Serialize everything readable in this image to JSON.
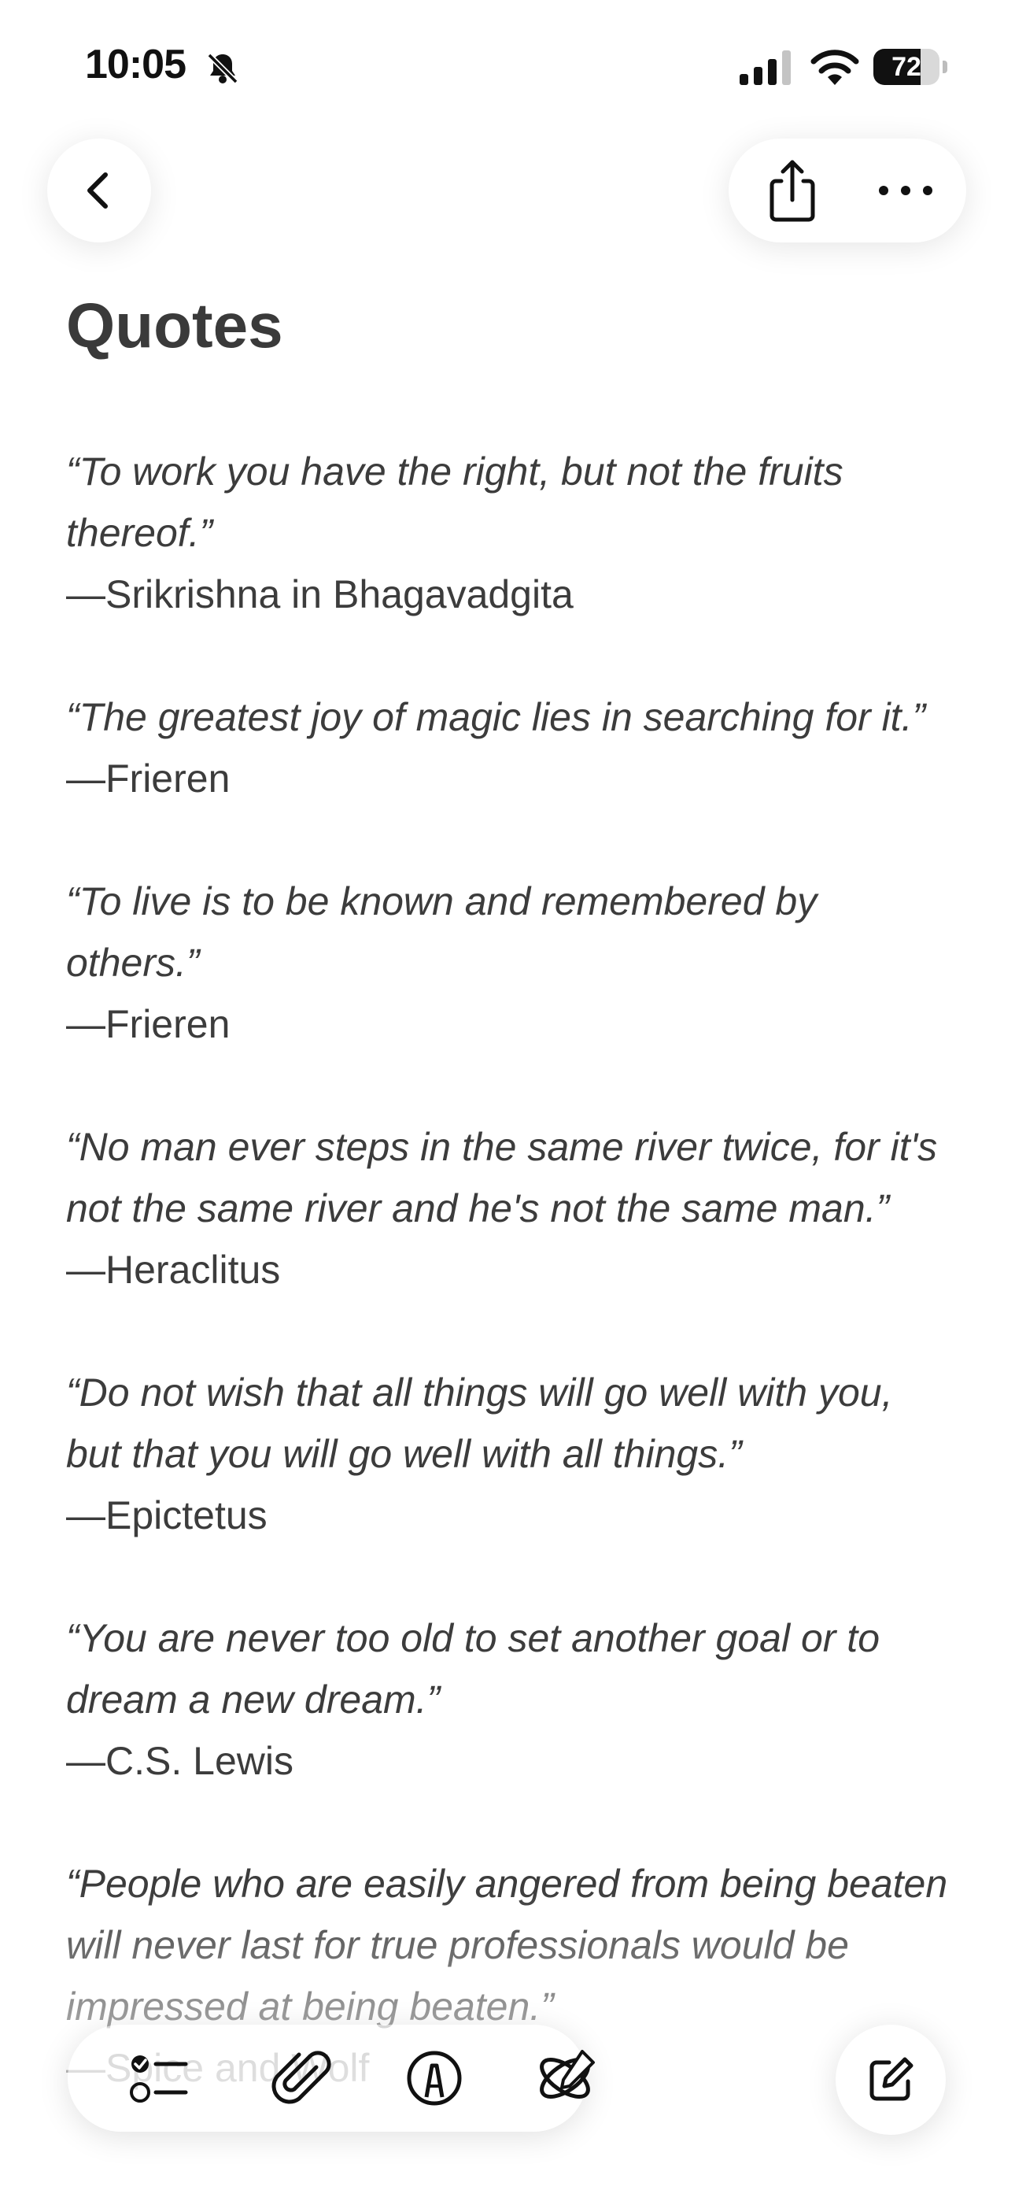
{
  "status_bar": {
    "time": "10:05",
    "battery_level": "72",
    "battery_fraction": 0.72,
    "icons": [
      "bell-slash-icon",
      "cellular-signal-icon",
      "wifi-icon",
      "battery-icon"
    ]
  },
  "nav": {
    "icons": [
      "chevron-left-icon",
      "share-icon",
      "ellipsis-icon"
    ]
  },
  "note": {
    "title": "Quotes",
    "quotes": [
      {
        "text": "“To work you have the right, but not the fruits thereof.”",
        "author": "—Srikrishna in Bhagavadgita"
      },
      {
        "text": "“The greatest joy of magic lies in searching for it.”",
        "author": "—Frieren"
      },
      {
        "text": "“To live is to be known and remembered by others.”",
        "author": "—Frieren"
      },
      {
        "text": "“No man ever steps in the same river twice, for it's not the same river and he's not the same man.”",
        "author": "—Heraclitus"
      },
      {
        "text": "“Do not wish that all things will go well with you, but that you will go well with all things.”",
        "author": "—Epictetus"
      },
      {
        "text": "“You are never too old to set another goal or to dream a new dream.”",
        "author": "—C.S. Lewis"
      },
      {
        "text": "“People who are easily angered from being beaten will never last for true professionals would be impressed at being beaten.”",
        "author": "—Spice and Wolf"
      }
    ]
  },
  "toolbar": {
    "icons": [
      "checklist-icon",
      "paperclip-icon",
      "markup-pen-icon",
      "writing-tools-icon",
      "compose-icon"
    ]
  }
}
